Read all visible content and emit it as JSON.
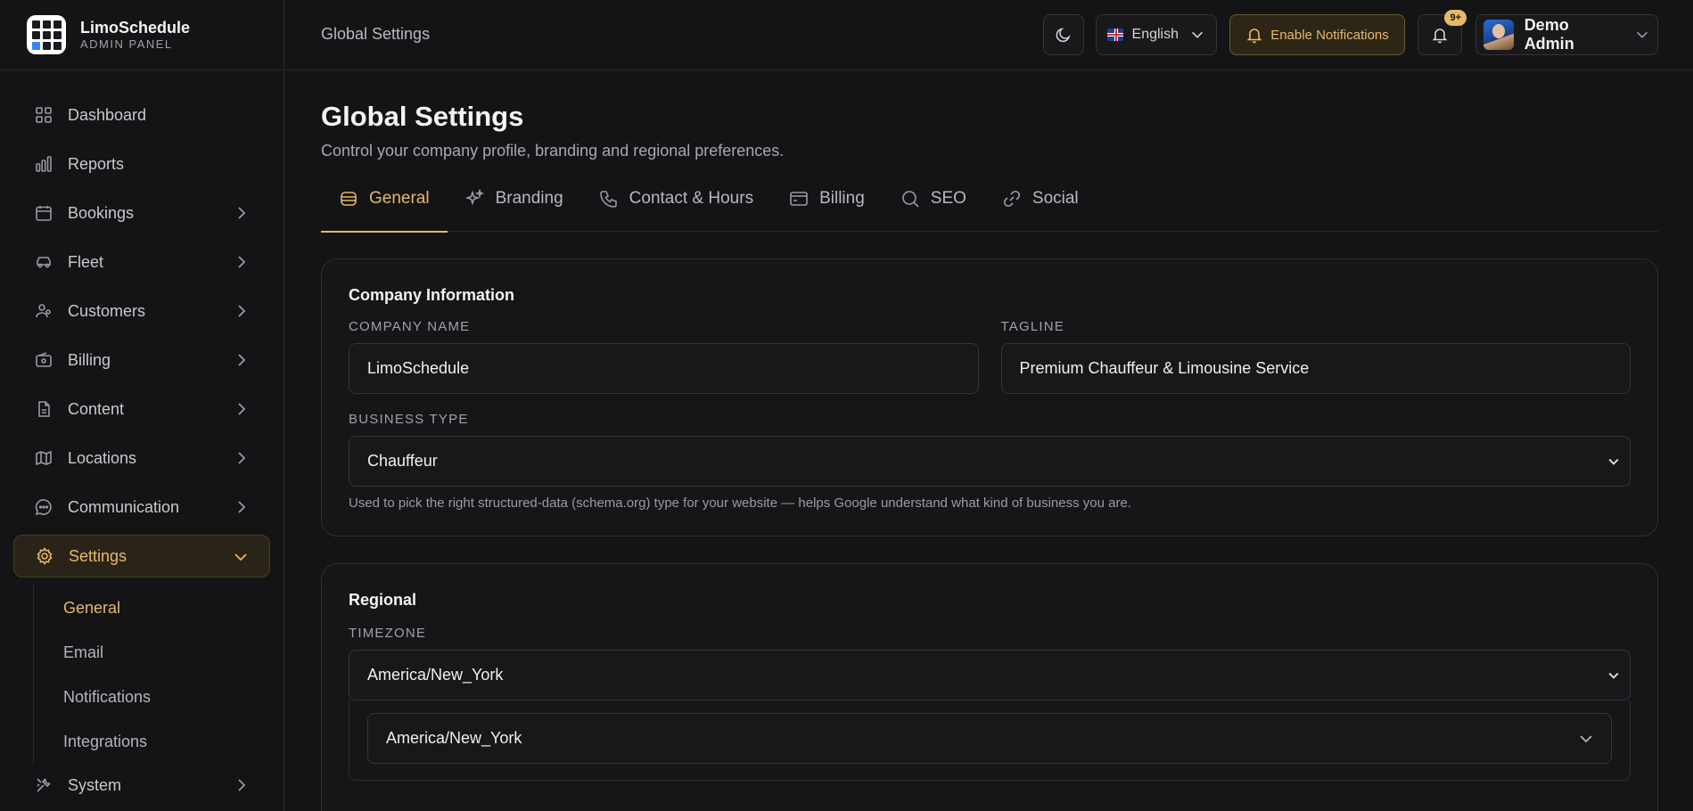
{
  "brand": {
    "name": "LimoSchedule",
    "subtitle": "ADMIN PANEL"
  },
  "topbar": {
    "title": "Global Settings",
    "language": "English",
    "enable_notifications": "Enable Notifications",
    "notif_badge": "9+",
    "user_name": "Demo Admin"
  },
  "sidebar": {
    "items": [
      {
        "label": "Dashboard",
        "icon": "grid-icon"
      },
      {
        "label": "Reports",
        "icon": "bar-chart-icon"
      },
      {
        "label": "Bookings",
        "icon": "calendar-icon"
      },
      {
        "label": "Fleet",
        "icon": "car-icon"
      },
      {
        "label": "Customers",
        "icon": "users-icon"
      },
      {
        "label": "Billing",
        "icon": "wallet-icon"
      },
      {
        "label": "Content",
        "icon": "document-icon"
      },
      {
        "label": "Locations",
        "icon": "map-icon"
      },
      {
        "label": "Communication",
        "icon": "chat-icon"
      },
      {
        "label": "Settings",
        "icon": "gear-icon"
      },
      {
        "label": "System",
        "icon": "tools-icon"
      }
    ],
    "settings_sub": [
      "General",
      "Email",
      "Notifications",
      "Integrations"
    ]
  },
  "page": {
    "title": "Global Settings",
    "description": "Control your company profile, branding and regional preferences."
  },
  "tabs": [
    "General",
    "Branding",
    "Contact & Hours",
    "Billing",
    "SEO",
    "Social"
  ],
  "company": {
    "section_title": "Company Information",
    "name_label": "COMPANY NAME",
    "name_value": "LimoSchedule",
    "tagline_label": "TAGLINE",
    "tagline_value": "Premium Chauffeur & Limousine Service",
    "business_type_label": "BUSINESS TYPE",
    "business_type_value": "Chauffeur",
    "business_type_help": "Used to pick the right structured-data (schema.org) type for your website — helps Google understand what kind of business you are."
  },
  "regional": {
    "section_title": "Regional",
    "timezone_label": "TIMEZONE",
    "timezone_value": "America/New_York",
    "timezone_inner_value": "America/New_York"
  },
  "colors": {
    "accent": "#e7b869",
    "background": "#141416",
    "border": "#2e2e33"
  }
}
